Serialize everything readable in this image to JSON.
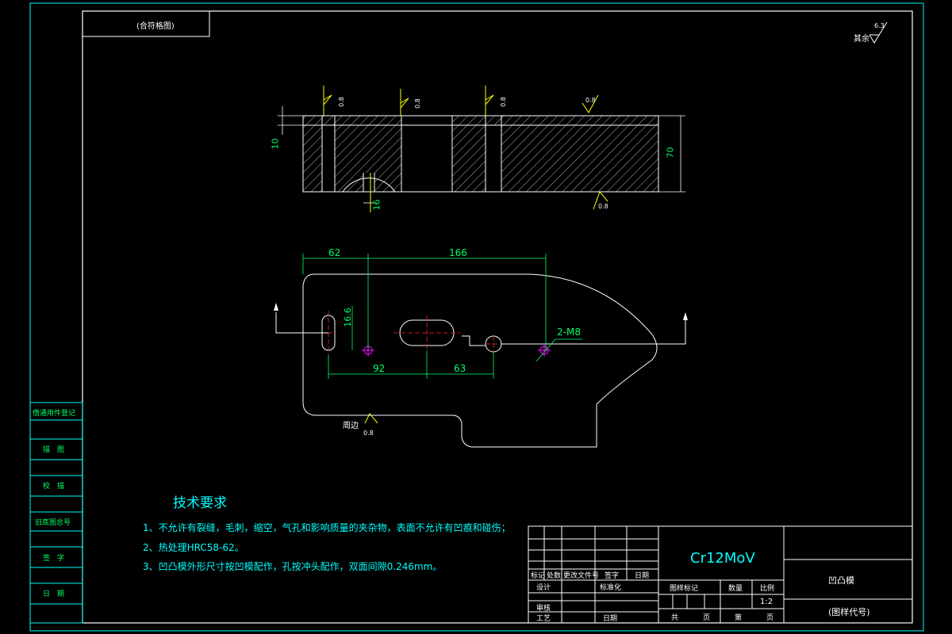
{
  "title_block_top": "(合符格图)",
  "roughness_other": {
    "label": "其余",
    "value": "6.3"
  },
  "side_column": [
    "借通用件登记",
    "描　图",
    "校　描",
    "旧底图总号",
    "签　字",
    "日　期"
  ],
  "section_view": {
    "roughness_labels": [
      "0.8",
      "0.8",
      "0.8",
      "0.8",
      "0.8"
    ],
    "dim_10": "10",
    "dim_70": "70",
    "dim_16": "16"
  },
  "plan_view": {
    "dim_62": "62",
    "dim_166": "166",
    "dim_16_6": "16.6",
    "dim_92": "92",
    "dim_63": "63",
    "thread_note": "2-M8",
    "perimeter_label": "周边",
    "perimeter_roughness": "0.8"
  },
  "tech_requirements": {
    "title": "技术要求",
    "items": [
      "1、不允许有裂缝，毛刺，缩空，气孔和影响质量的夹杂物，表面不允许有凹痕和碰伤；",
      "2、热处理HRC58-62。",
      "3、凹凸模外形尺寸按凹模配作，孔按冲头配作，双面间隙0.246mm。"
    ]
  },
  "title_block": {
    "material": "Cr12MoV",
    "part_name": "凹凸模",
    "drawing_code": "(图样代号)",
    "rev_headers": [
      "标记",
      "处数",
      "更改文件号",
      "签字",
      "日期"
    ],
    "design": "设计",
    "standardize": "标准化",
    "review": "审核",
    "process": "工艺",
    "date": "日期",
    "stage_mark": "图样标记",
    "weight": "数量",
    "scale_label": "比例",
    "scale_value": "1:2",
    "total": "共",
    "sheet": "页",
    "sheet_no": "第",
    "sheet_unit": "页"
  }
}
